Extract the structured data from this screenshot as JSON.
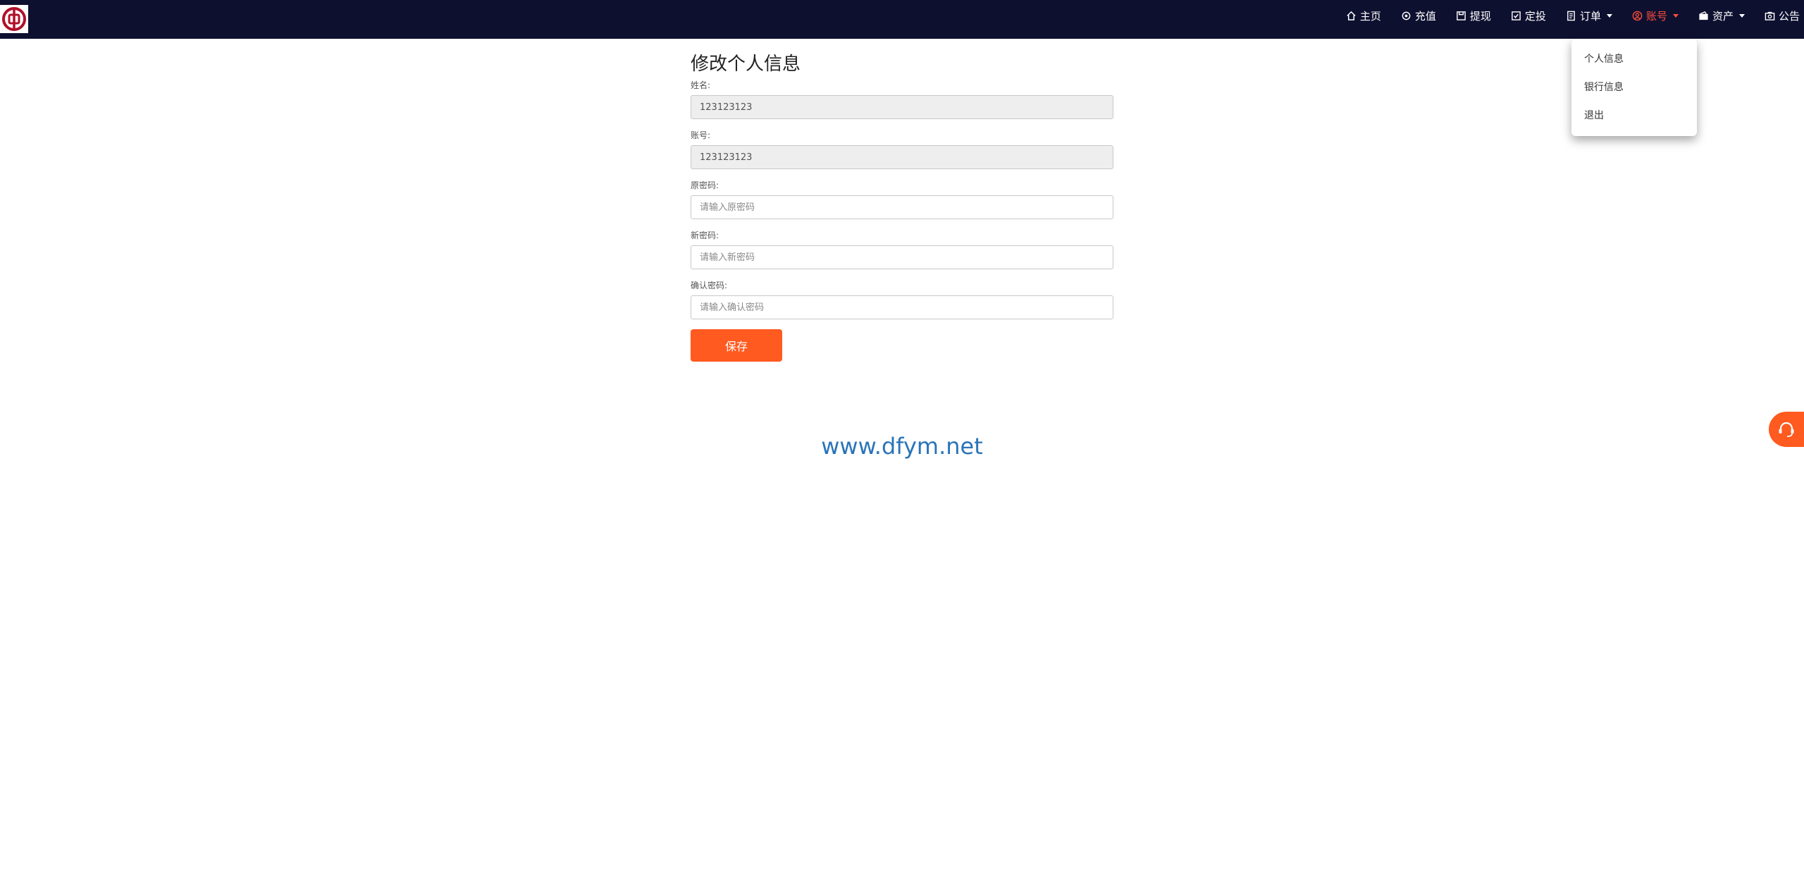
{
  "nav": {
    "items": [
      {
        "label": "主页",
        "icon": "home-icon"
      },
      {
        "label": "充值",
        "icon": "recharge-icon"
      },
      {
        "label": "提现",
        "icon": "withdraw-icon"
      },
      {
        "label": "定投",
        "icon": "check-square-icon"
      },
      {
        "label": "订单",
        "icon": "document-icon",
        "has_dropdown": true
      },
      {
        "label": "账号",
        "icon": "user-circle-icon",
        "has_dropdown": true,
        "active": true
      },
      {
        "label": "资产",
        "icon": "wallet-icon",
        "has_dropdown": true
      },
      {
        "label": "公告",
        "icon": "announcement-icon"
      }
    ]
  },
  "account_menu": {
    "items": [
      {
        "label": "个人信息"
      },
      {
        "label": "银行信息"
      },
      {
        "label": "退出"
      }
    ]
  },
  "form": {
    "title": "修改个人信息",
    "name": {
      "label": "姓名:",
      "value": "123123123"
    },
    "account": {
      "label": "账号:",
      "value": "123123123"
    },
    "old_password": {
      "label": "原密码:",
      "placeholder": "请输入原密码"
    },
    "new_password": {
      "label": "新密码:",
      "placeholder": "请输入新密码"
    },
    "confirm_password": {
      "label": "确认密码:",
      "placeholder": "请输入确认密码"
    },
    "save_label": "保存"
  },
  "site_url": "www.dfym.net",
  "colors": {
    "topbar": "#0e1030",
    "active_nav": "#ff4d3a",
    "accent": "#ff5a1f",
    "link": "#2a74b8"
  }
}
